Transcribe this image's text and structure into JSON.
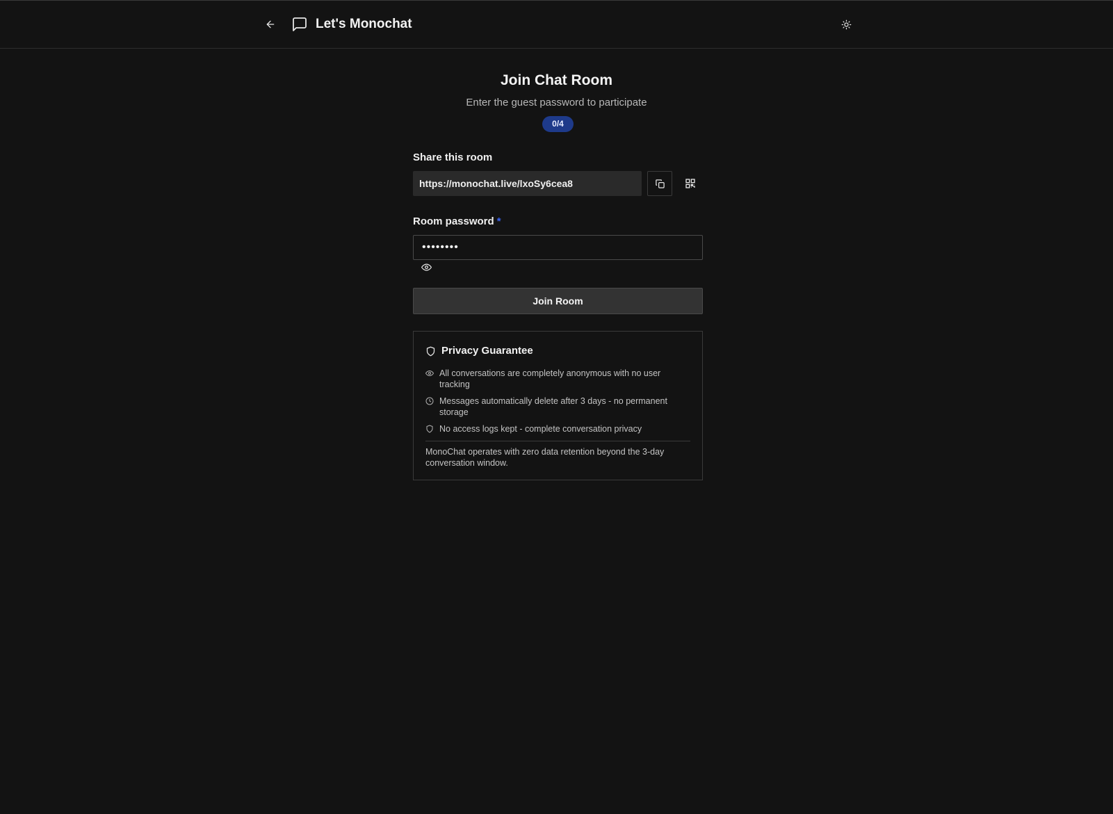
{
  "header": {
    "app_title": "Let's Monochat",
    "back_icon": "arrow-left-icon",
    "logo_icon": "message-square-icon",
    "theme_icon": "sun-icon"
  },
  "main": {
    "title": "Join Chat Room",
    "subtitle": "Enter the guest password to participate",
    "participant_count": "0/4",
    "share": {
      "label": "Share this room",
      "url": "https://monochat.live/lxoSy6cea8",
      "copy_icon": "copy-icon",
      "qr_icon": "qr-code-icon"
    },
    "password": {
      "label": "Room password",
      "required_mark": "*",
      "value": "••••••••",
      "toggle_icon": "eye-icon"
    },
    "join_label": "Join Room"
  },
  "privacy": {
    "title": "Privacy Guarantee",
    "items": [
      {
        "icon": "eye-icon",
        "text": "All conversations are completely anonymous with no user tracking"
      },
      {
        "icon": "clock-icon",
        "text": "Messages automatically delete after 3 days - no permanent storage"
      },
      {
        "icon": "shield-icon",
        "text": "No access logs kept - complete conversation privacy"
      }
    ],
    "footer": "MonoChat operates with zero data retention beyond the 3-day conversation window."
  },
  "colors": {
    "background": "#131313",
    "badge": "#1e3a8a",
    "required": "#3b64f0",
    "button": "#333333"
  }
}
